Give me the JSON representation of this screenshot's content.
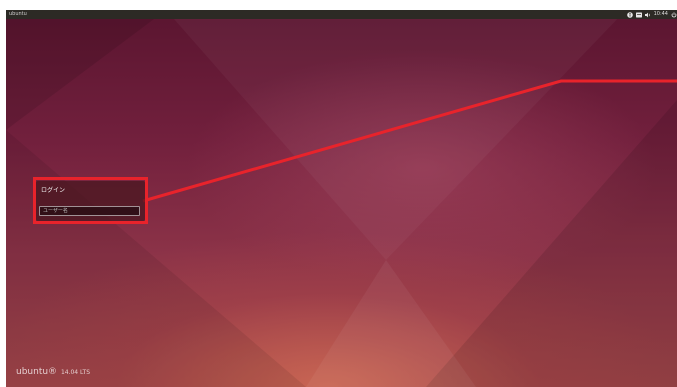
{
  "topbar": {
    "hostname": "ubuntu",
    "clock": "10:44",
    "icons": [
      "accessibility-icon",
      "keyboard-layout-icon",
      "volume-icon",
      "power-icon"
    ]
  },
  "login": {
    "title": "ログイン",
    "username_placeholder": "ユーザー名"
  },
  "branding": {
    "logo_text": "ubuntu®",
    "version": "14.04 LTS"
  },
  "colors": {
    "callout": "#e8232b",
    "topbar": "#2c2a25",
    "accent": "#7a2040"
  }
}
